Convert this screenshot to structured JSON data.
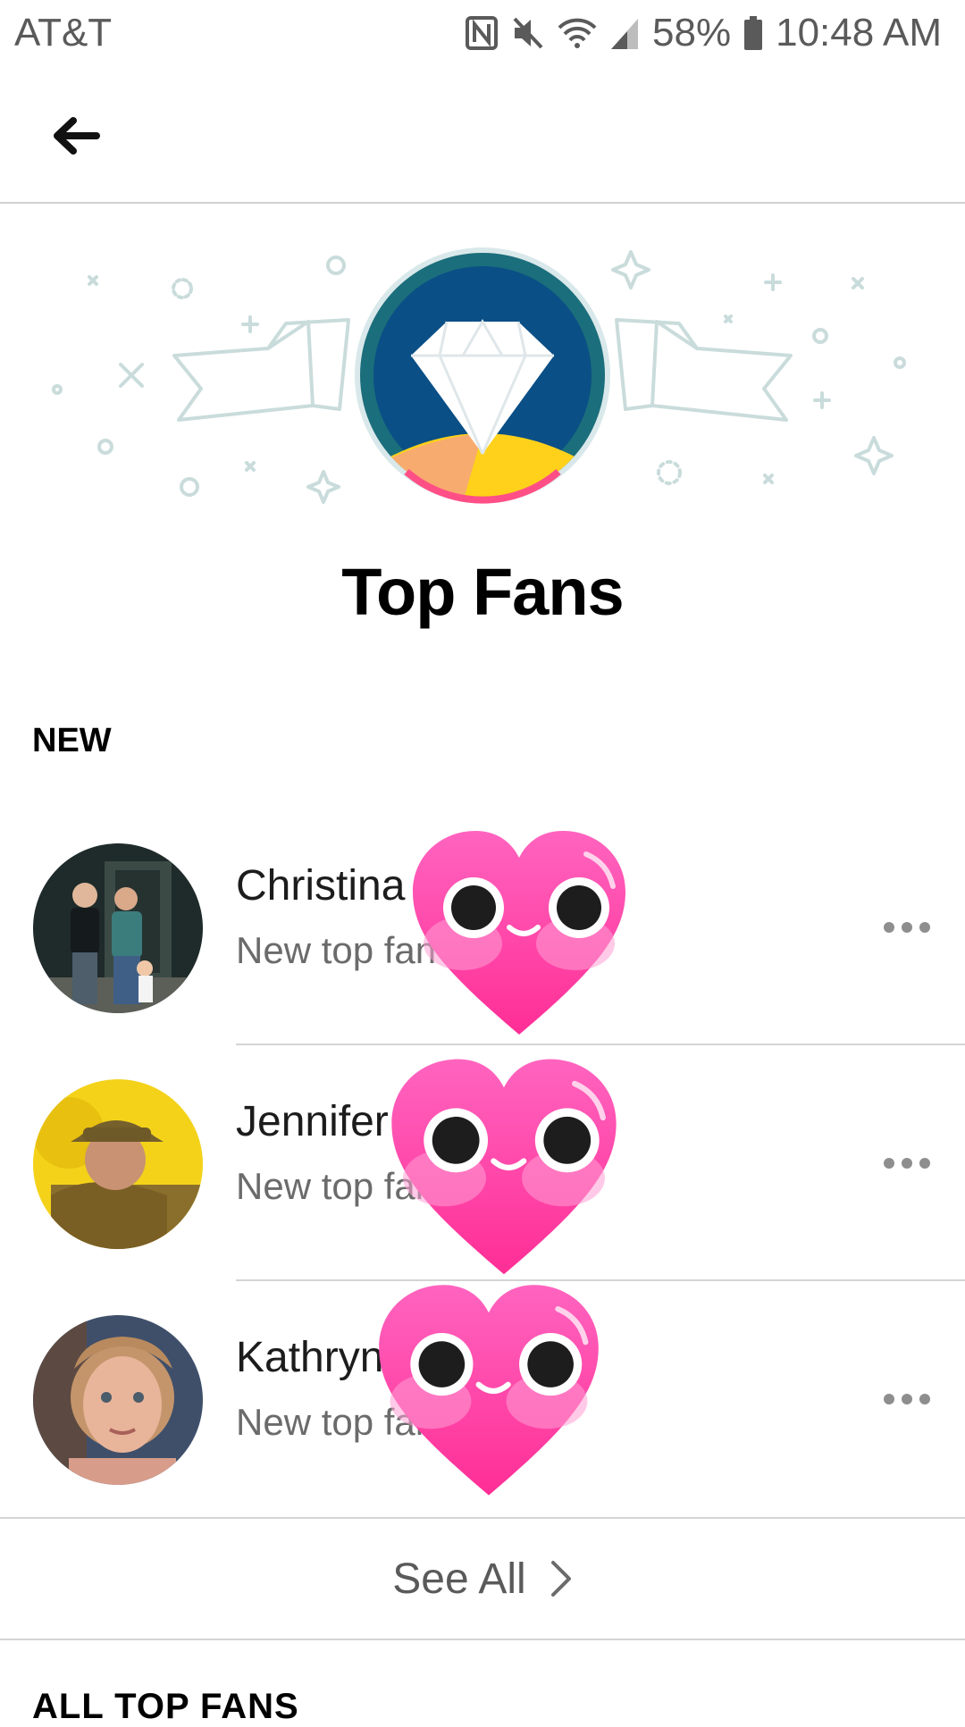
{
  "status_bar": {
    "carrier": "AT&T",
    "battery": "58%",
    "time": "10:48 AM",
    "icons": [
      "nfc-icon",
      "mute-icon",
      "wifi-icon",
      "signal-icon",
      "battery-icon"
    ]
  },
  "header": {
    "back_icon": "back-arrow-icon"
  },
  "hero": {
    "badge_icon": "diamond-icon"
  },
  "page": {
    "title": "Top Fans"
  },
  "sections": {
    "new_label": "NEW",
    "all_label": "ALL TOP FANS"
  },
  "fans": [
    {
      "name": "Christina",
      "subtitle": "New top fan",
      "more_icon": "more-icon"
    },
    {
      "name": "Jennifer",
      "subtitle": "New top fan",
      "more_icon": "more-icon"
    },
    {
      "name": "Kathryn",
      "subtitle": "New top fan",
      "more_icon": "more-icon"
    }
  ],
  "see_all": {
    "label": "See All",
    "icon": "chevron-right-icon"
  },
  "colors": {
    "badge_blue": "#0a4f86",
    "heart_pink": "#ff3fa4",
    "text_gray": "#6b6b6b",
    "divider": "#d4d4d4"
  }
}
